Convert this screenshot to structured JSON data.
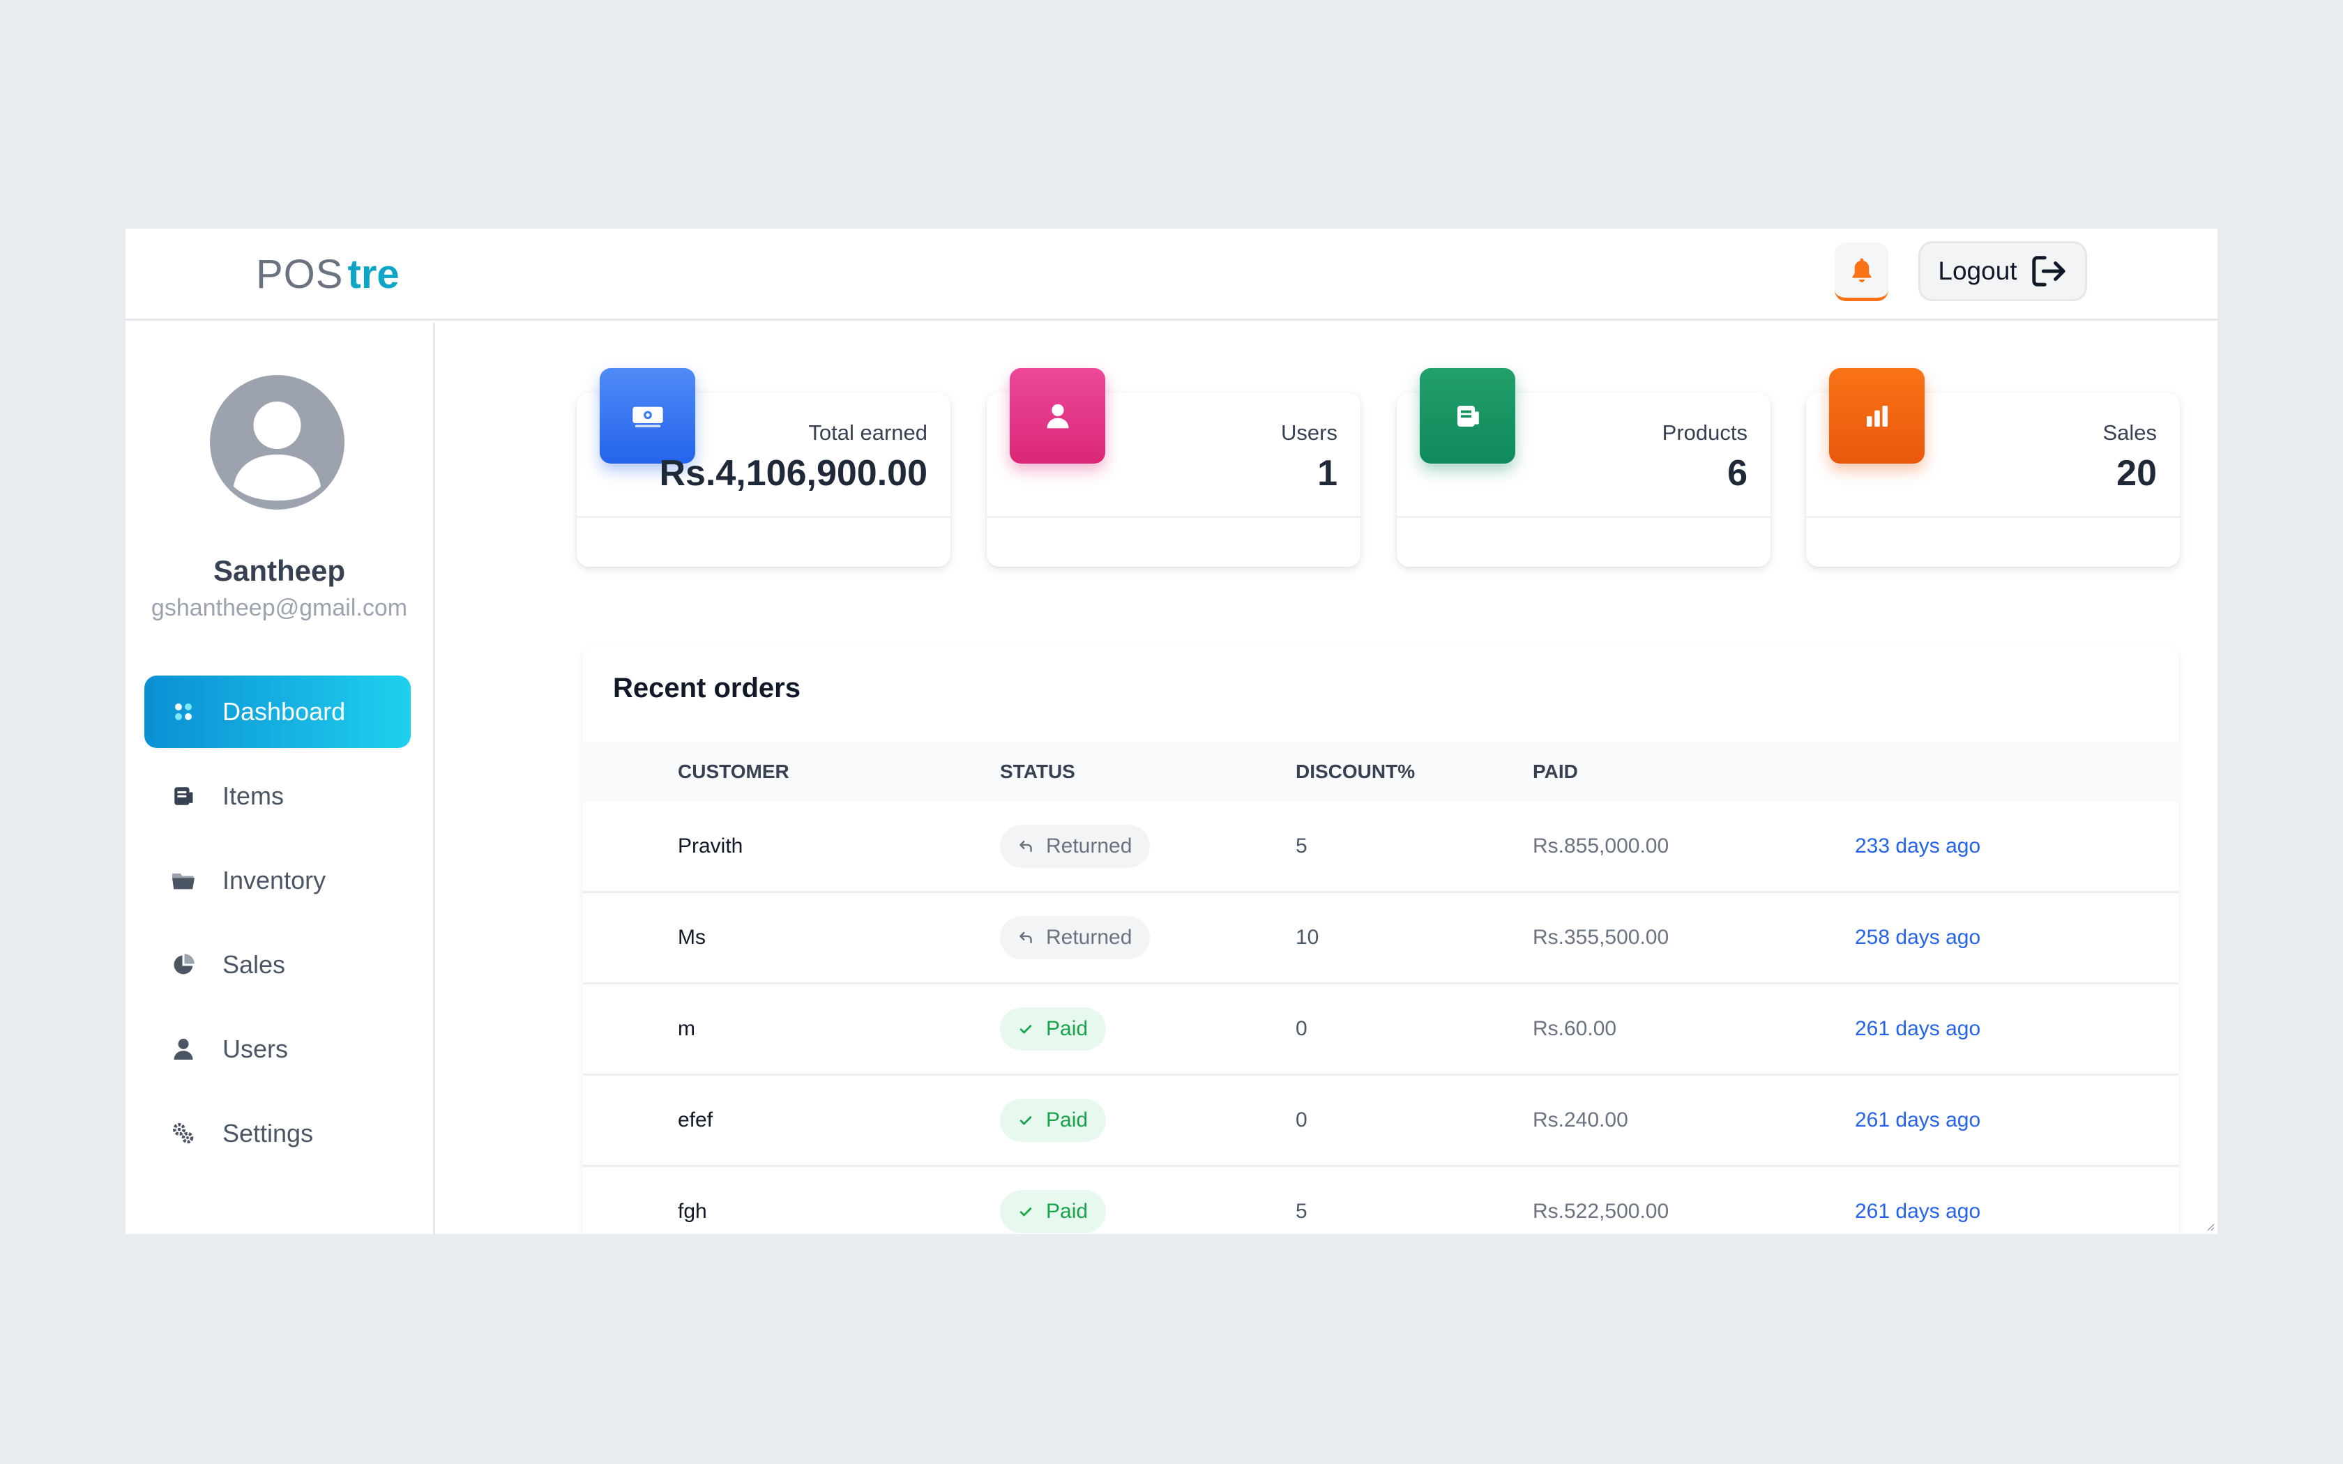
{
  "header": {
    "logo_pos": "POS",
    "logo_tre": "tre",
    "logout_label": "Logout"
  },
  "profile": {
    "name": "Santheep",
    "email": "gshantheep@gmail.com"
  },
  "sidebar": {
    "items": [
      {
        "label": "Dashboard",
        "icon": "dashboard-icon",
        "active": true
      },
      {
        "label": "Items",
        "icon": "items-icon"
      },
      {
        "label": "Inventory",
        "icon": "folder-icon"
      },
      {
        "label": "Sales",
        "icon": "pie-chart-icon"
      },
      {
        "label": "Users",
        "icon": "user-icon"
      },
      {
        "label": "Settings",
        "icon": "settings-icon"
      }
    ]
  },
  "stats": [
    {
      "label": "Total earned",
      "value": "Rs.4,106,900.00",
      "icon": "money-icon",
      "color": "#2563eb"
    },
    {
      "label": "Users",
      "value": "1",
      "icon": "user-icon",
      "color": "#db2777"
    },
    {
      "label": "Products",
      "value": "6",
      "icon": "products-icon",
      "color": "#0f8a5c"
    },
    {
      "label": "Sales",
      "value": "20",
      "icon": "bar-chart-icon",
      "color": "#ea580c"
    }
  ],
  "orders": {
    "title": "Recent orders",
    "columns": [
      "CUSTOMER",
      "STATUS",
      "DISCOUNT%",
      "PAID"
    ],
    "rows": [
      {
        "customer": "Pravith",
        "status": "Returned",
        "discount": "5",
        "paid": "Rs.855,000.00",
        "time": "233 days ago"
      },
      {
        "customer": "Ms",
        "status": "Returned",
        "discount": "10",
        "paid": "Rs.355,500.00",
        "time": "258 days ago"
      },
      {
        "customer": "m",
        "status": "Paid",
        "discount": "0",
        "paid": "Rs.60.00",
        "time": "261 days ago"
      },
      {
        "customer": "efef",
        "status": "Paid",
        "discount": "0",
        "paid": "Rs.240.00",
        "time": "261 days ago"
      },
      {
        "customer": "fgh",
        "status": "Paid",
        "discount": "5",
        "paid": "Rs.522,500.00",
        "time": "261 days ago"
      }
    ]
  },
  "colors": {
    "accent": "#0ea5c6",
    "link": "#2563eb",
    "paid_text": "#16a34a",
    "returned_text": "#6b7280"
  }
}
